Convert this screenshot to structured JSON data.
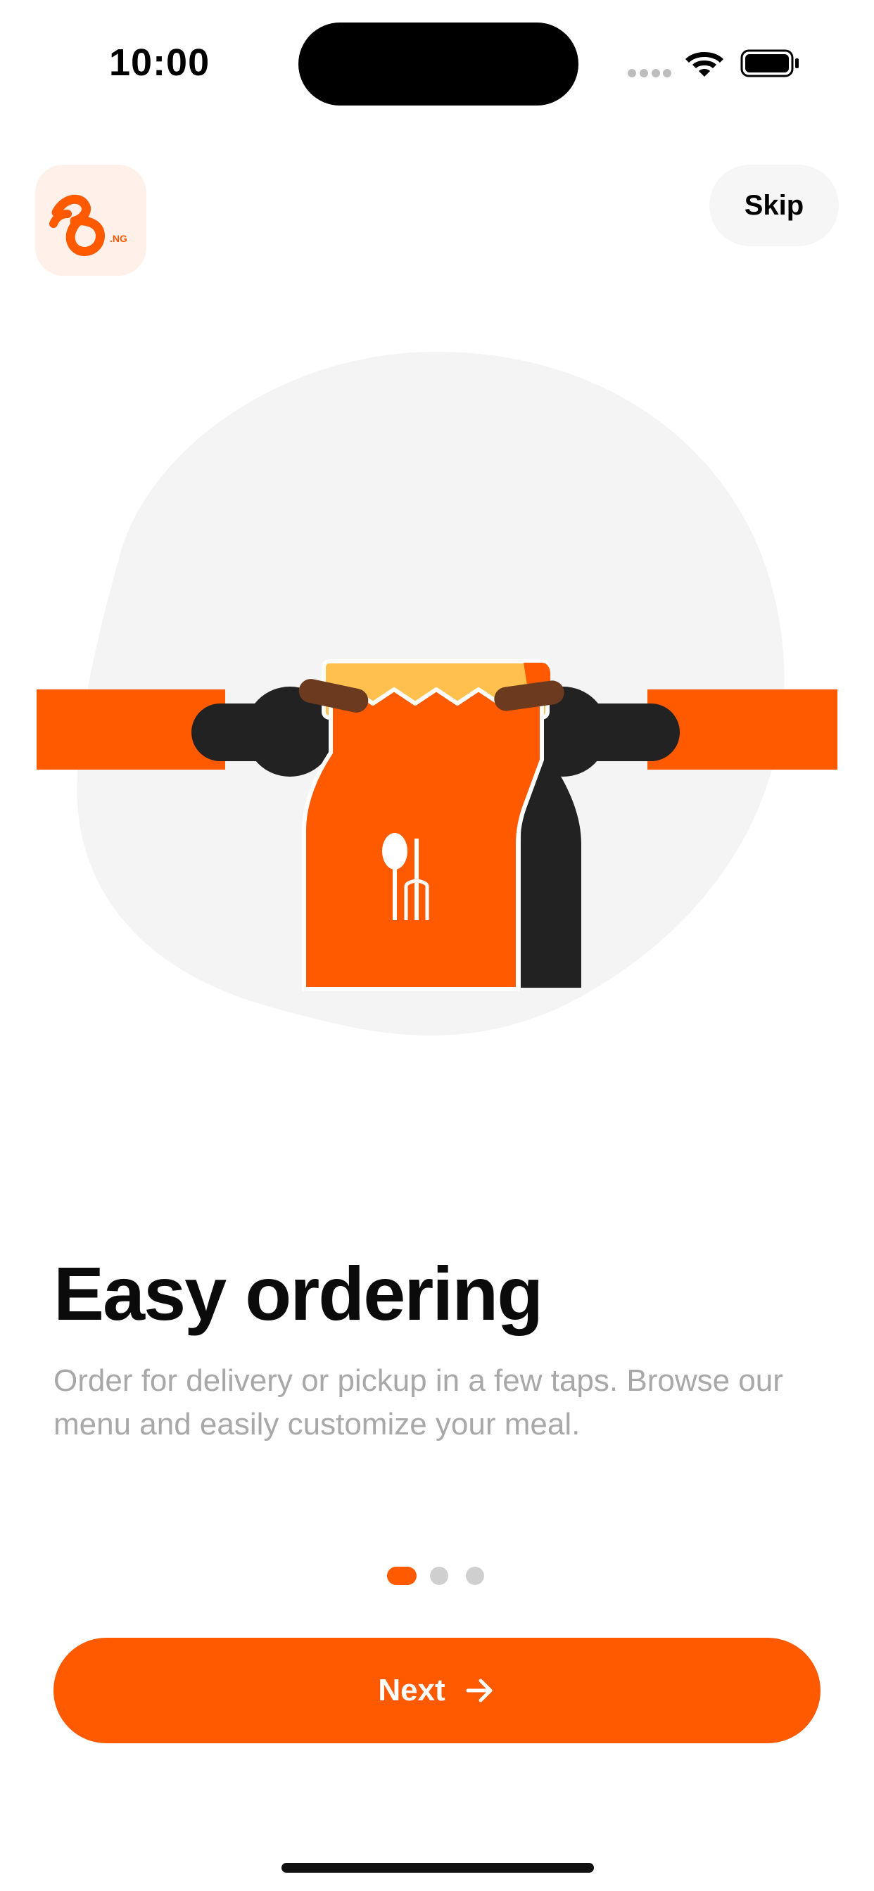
{
  "status_bar": {
    "time": "10:00",
    "signal_icon": "cellular-signal-icon",
    "wifi_icon": "wifi-icon",
    "battery_icon": "battery-icon"
  },
  "header": {
    "logo_icon": "brand-logo-icon",
    "logo_mark_text": ".NG",
    "skip_label": "Skip"
  },
  "illustration": {
    "name": "delivery-rider-icon"
  },
  "onboarding": {
    "title": "Easy ordering",
    "description": "Order for delivery or pickup in a few taps. Browse our menu and easily customize your meal.",
    "current_page": 1,
    "total_pages": 3
  },
  "actions": {
    "next_label": "Next",
    "next_icon": "arrow-right-icon"
  },
  "colors": {
    "accent": "#ff5a00",
    "logo_bg": "#fff1ea",
    "muted_text": "#a8a8a8",
    "dot_inactive": "#cfcfcf"
  }
}
